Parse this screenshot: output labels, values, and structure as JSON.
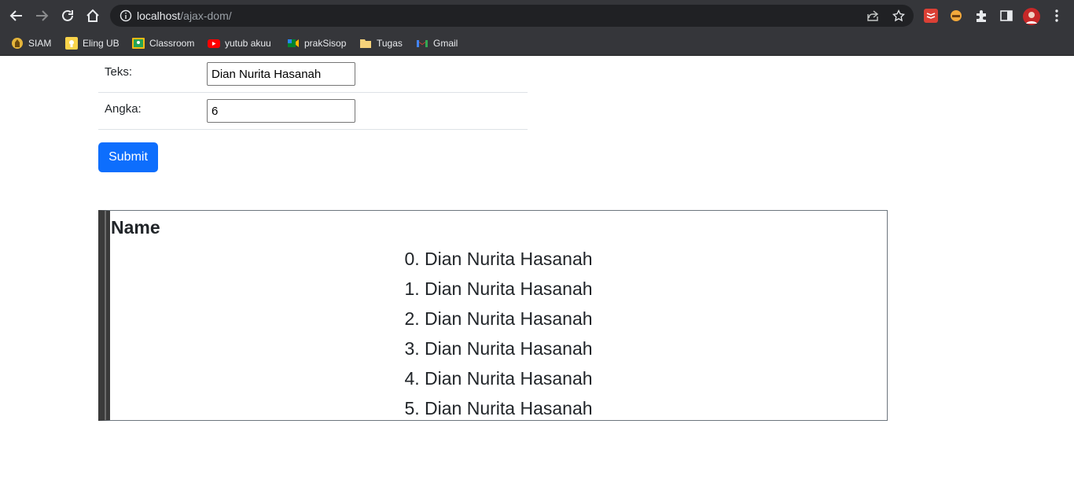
{
  "browser": {
    "url_host": "localhost",
    "url_path": "/ajax-dom/",
    "bookmarks": [
      {
        "label": "SIAM",
        "icon": "siam-icon"
      },
      {
        "label": "Eling UB",
        "icon": "bulb-icon"
      },
      {
        "label": "Classroom",
        "icon": "classroom-icon"
      },
      {
        "label": "yutub akuu",
        "icon": "youtube-icon"
      },
      {
        "label": "prakSisop",
        "icon": "meet-icon"
      },
      {
        "label": "Tugas",
        "icon": "folder-icon"
      },
      {
        "label": "Gmail",
        "icon": "gmail-icon"
      }
    ]
  },
  "form": {
    "teks_label": "Teks:",
    "teks_value": "Dian Nurita Hasanah",
    "angka_label": "Angka:",
    "angka_value": "6",
    "submit_label": "Submit"
  },
  "result": {
    "heading": "Name",
    "items": [
      "0. Dian Nurita Hasanah",
      "1. Dian Nurita Hasanah",
      "2. Dian Nurita Hasanah",
      "3. Dian Nurita Hasanah",
      "4. Dian Nurita Hasanah",
      "5. Dian Nurita Hasanah"
    ]
  },
  "colors": {
    "submit_bg": "#0d6efd",
    "chrome_bg": "#35363a"
  }
}
